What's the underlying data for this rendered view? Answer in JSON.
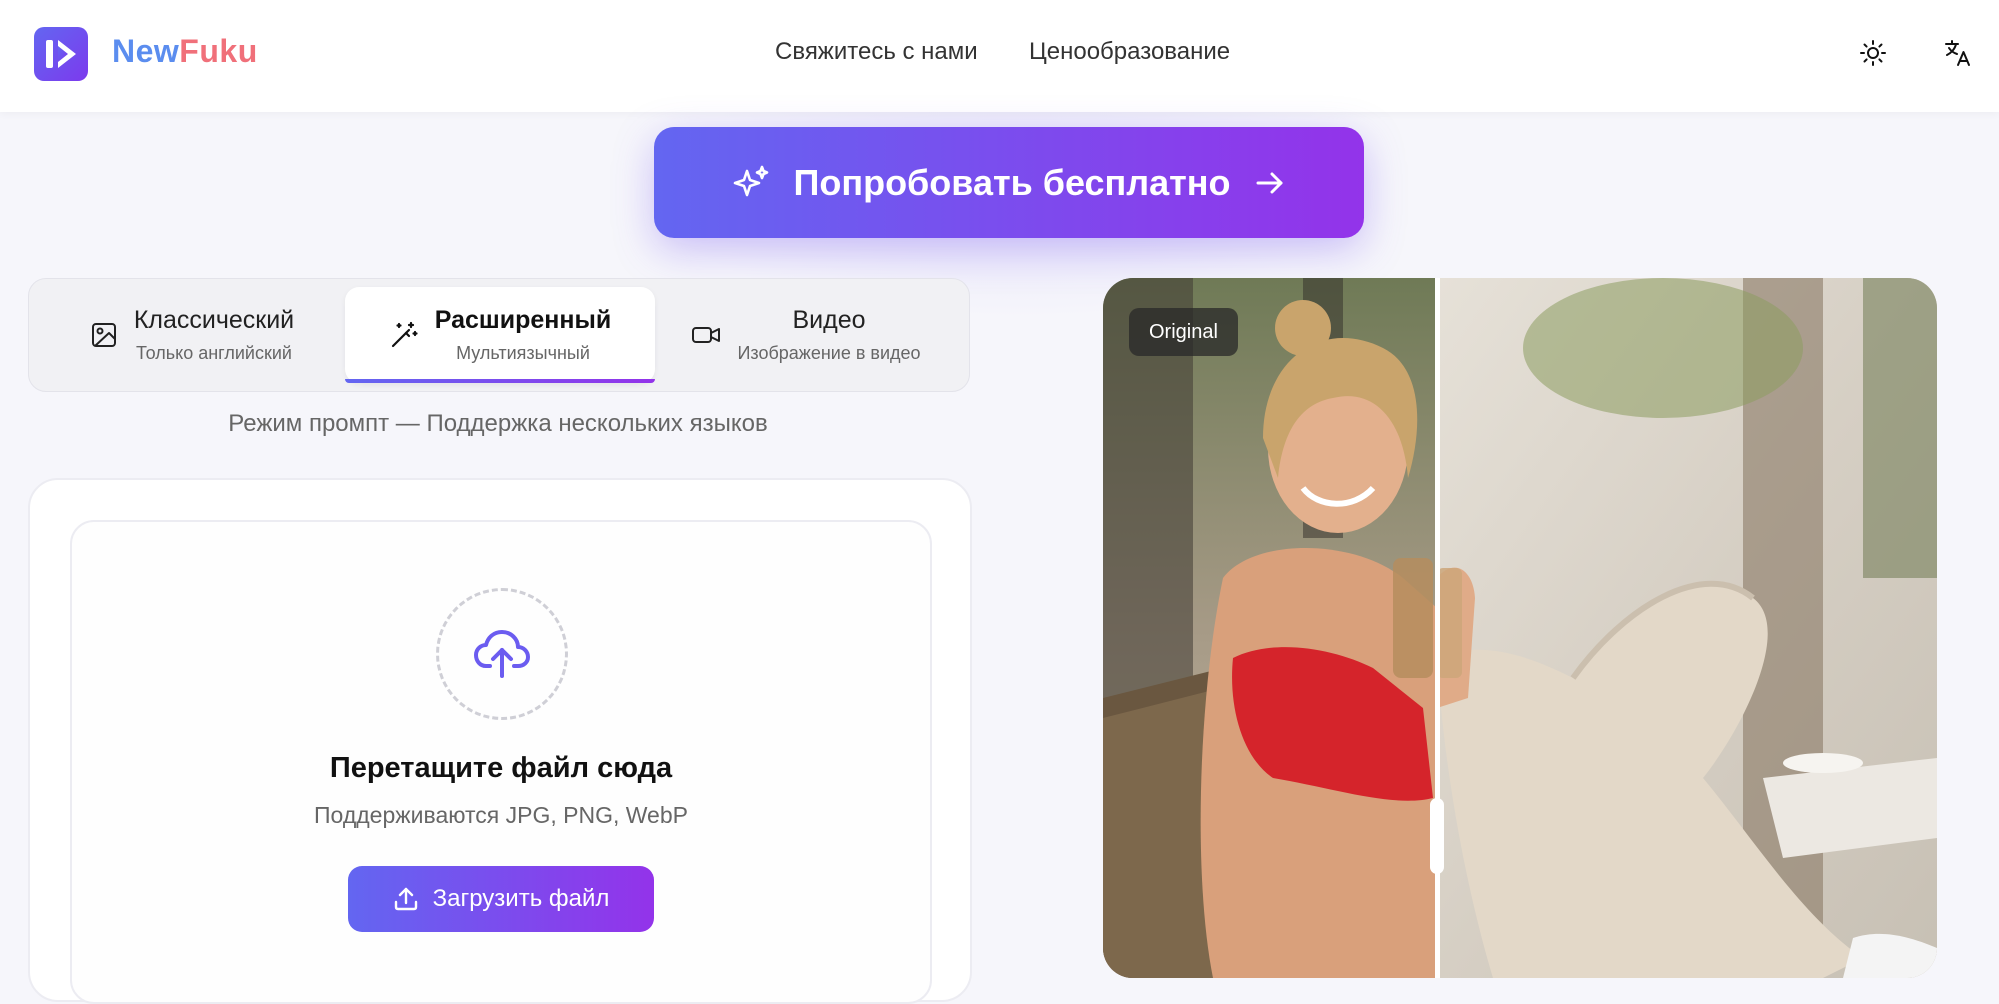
{
  "header": {
    "brand_part1": "New",
    "brand_part2": "Fuku",
    "nav": [
      "Свяжитесь с нами",
      "Ценообразование"
    ],
    "icons": [
      "sun-icon",
      "translate-icon"
    ]
  },
  "cta": {
    "label": "Попробовать бесплатно"
  },
  "tabs": [
    {
      "title": "Классический",
      "subtitle": "Только английский",
      "icon": "image-icon",
      "active": false
    },
    {
      "title": "Расширенный",
      "subtitle": "Мультиязычный",
      "icon": "magic-wand-icon",
      "active": true
    },
    {
      "title": "Видео",
      "subtitle": "Изображение в видео",
      "icon": "video-camera-icon",
      "active": false
    }
  ],
  "mode_text": "Режим промпт — Поддержка нескольких языков",
  "upload": {
    "title": "Перетащите файл сюда",
    "subtitle": "Поддерживаются JPG, PNG, WebP",
    "button_label": "Загрузить файл"
  },
  "compare": {
    "badge": "Original"
  },
  "colors": {
    "accent_start": "#6366f1",
    "accent_end": "#9333ea",
    "brand_blue": "#5b8def",
    "brand_red": "#f0707a"
  }
}
